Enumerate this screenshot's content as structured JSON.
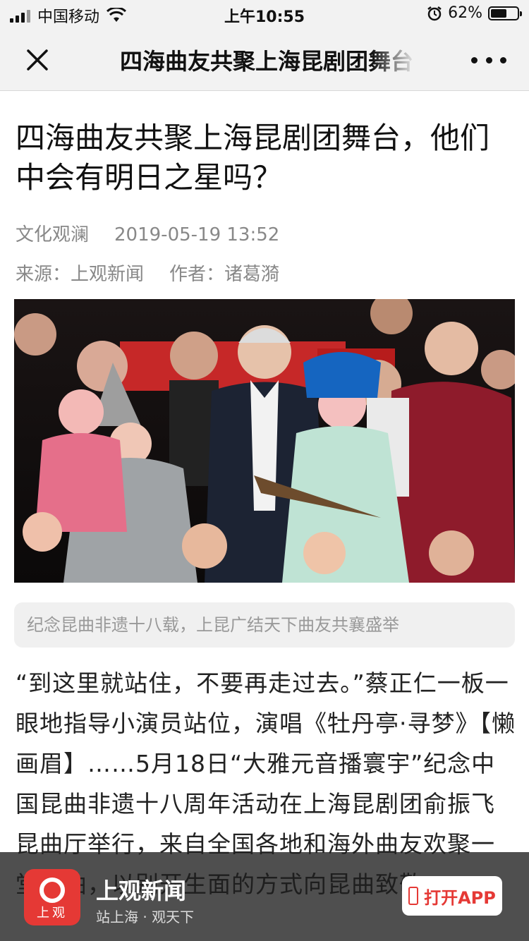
{
  "status_bar": {
    "carrier": "中国移动",
    "time": "上午10:55",
    "battery_percent": "62%",
    "battery_level": 0.62,
    "icons": [
      "signal-icon",
      "wifi-icon",
      "alarm-icon",
      "battery-icon"
    ]
  },
  "nav": {
    "title": "四海曲友共聚上海昆剧团舞台，他们中会有明日之星吗？",
    "close_icon": "close-icon",
    "more_icon": "more-icon"
  },
  "article": {
    "headline": "四海曲友共聚上海昆剧团舞台，他们中会有明日之星吗？",
    "channel": "文化观澜",
    "date": "2019-05-19 13:52",
    "source": "来源：上观新闻",
    "author": "作者：诸葛漪",
    "image_alt": "photo",
    "caption": "纪念昆曲非遗十八载，上昆广结天下曲友共襄盛举",
    "body": "“到这里就站住，不要再走过去。”蔡正仁一板一眼地指导小演员站位，演唱《牡丹亭·寻梦》【懒画眉】……5月18日“大雅元音播寰宇”纪念中国昆曲非遗十八周年活动在上海昆剧团俞振飞昆曲厅举行，来自全国各地和海外曲友欢聚一堂拍曲，以别开生面的方式向昆曲致敬。"
  },
  "banner": {
    "logo_text": "上观",
    "app_name": "上观新闻",
    "slogan": "站上海 · 观天下",
    "open_label": "打开APP",
    "accent": "#e53935"
  }
}
